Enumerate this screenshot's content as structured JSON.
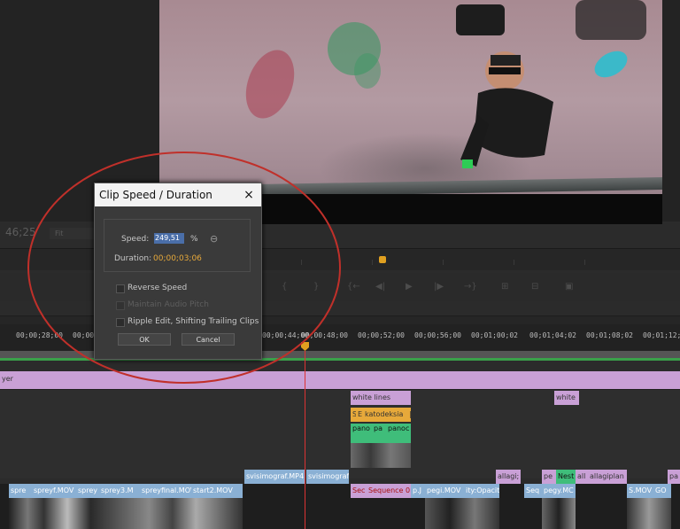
{
  "monitor": {
    "timecode": "46;25",
    "fit": "Fit"
  },
  "timeline": {
    "timecodes": [
      "00;00;28;00",
      "00;00;",
      "00;00;44;00",
      "00;00;48;00",
      "00;00;52;00",
      "00;00;56;00",
      "00;01;00;02",
      "00;01;04;02",
      "00;01;08;02",
      "00;01;12;0"
    ],
    "track_label": "yer",
    "clips_v4": [
      "white lines",
      "white"
    ],
    "clips_v3": [
      "S",
      "E",
      "katodeksia",
      "|"
    ],
    "clips_v2": [
      "pano",
      "pa",
      "panoc"
    ],
    "clips_v1_top": [
      "svisimograf.MP4",
      "svisimograf",
      "allagi;",
      "pe",
      "Nest",
      "all",
      "allagiplan",
      "pa"
    ],
    "clips_v1": [
      "spre",
      "spreyf.MOV",
      "sprey",
      "sprey3.M",
      "spreyfinal.MOV",
      "start2.MOV",
      "Sec",
      "Sequence 0",
      "p.J",
      "pegi.MOV",
      "ity:Opacity",
      "Seq",
      "pegy.MC",
      "S.MOV",
      "GO"
    ]
  },
  "dialog": {
    "title": "Clip Speed / Duration",
    "close": "×",
    "speed_label": "Speed:",
    "speed_value": "249,51",
    "speed_unit": "%",
    "link_icon": "⊖",
    "duration_label": "Duration:",
    "duration_value": "00;00;03;06",
    "reverse": "Reverse Speed",
    "maintain": "Maintain Audio Pitch",
    "ripple": "Ripple Edit, Shifting Trailing Clips",
    "ok": "OK",
    "cancel": "Cancel"
  },
  "colors": {
    "pink": "#c9a0d6",
    "blue": "#8ab0d4",
    "orange": "#e7a93a",
    "green": "#3fbd7a",
    "selected": "#4a6ea8"
  }
}
